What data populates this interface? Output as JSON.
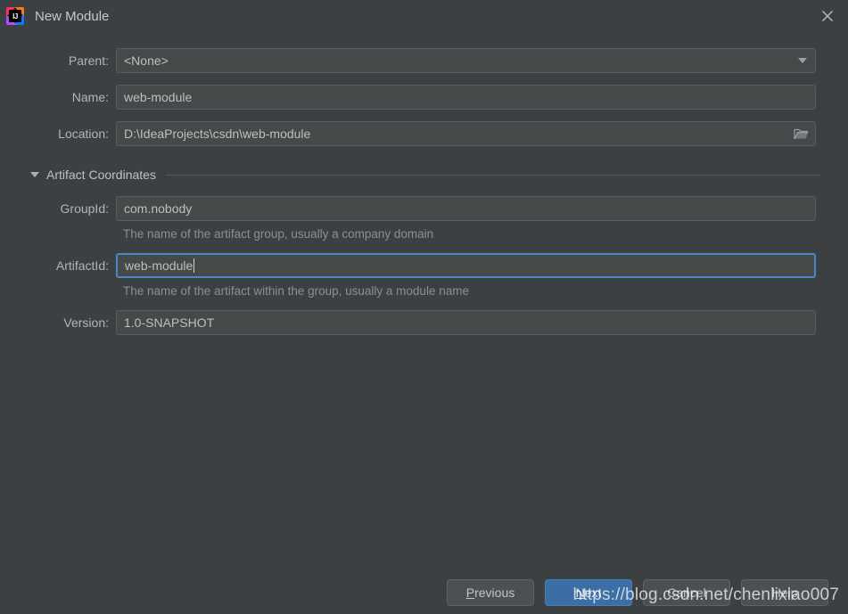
{
  "window": {
    "title": "New Module",
    "app_icon": "intellij-idea-logo",
    "icon_text": "IJ",
    "close_icon": "close-icon"
  },
  "form": {
    "parent": {
      "label": "Parent:",
      "value": "<None>",
      "icon": "chevron-down-icon"
    },
    "name": {
      "label": "Name:",
      "value": "web-module"
    },
    "location": {
      "label": "Location:",
      "value": "D:\\IdeaProjects\\csdn\\web-module",
      "icon": "folder-icon"
    }
  },
  "artifact_section": {
    "title": "Artifact Coordinates",
    "expanded": true,
    "collapse_icon": "triangle-down-icon",
    "group_id": {
      "label": "GroupId:",
      "value": "com.nobody",
      "hint": "The name of the artifact group, usually a company domain"
    },
    "artifact_id": {
      "label": "ArtifactId:",
      "value": "web-module",
      "hint": "The name of the artifact within the group, usually a module name",
      "focused": true
    },
    "version": {
      "label": "Version:",
      "value": "1.0-SNAPSHOT"
    }
  },
  "buttons": {
    "previous": {
      "label_pre": "",
      "mnemonic": "P",
      "label_post": "revious"
    },
    "next": {
      "label_pre": "",
      "mnemonic": "N",
      "label_post": "ext",
      "default": true
    },
    "cancel": {
      "label": "Cancel"
    },
    "help": {
      "label": "Help"
    }
  },
  "watermark": {
    "text": "https://blog.csdn.net/chenlixiao007"
  },
  "colors": {
    "background": "#3c4043",
    "field_background": "#45494a",
    "focus_border": "#4e86c7",
    "primary_button": "#3b6ea5",
    "label_text": "#b4b4b4",
    "hint_text": "#8b8f91"
  }
}
